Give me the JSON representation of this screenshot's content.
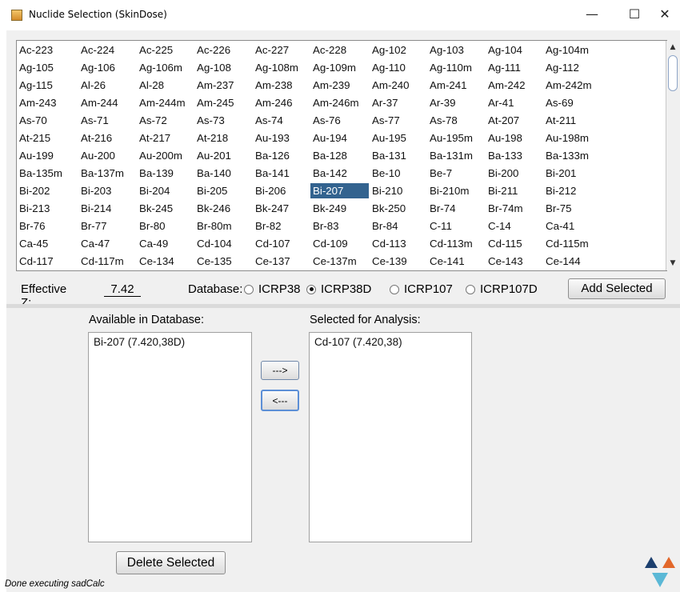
{
  "window": {
    "title": "Nuclide Selection (SkinDose)",
    "minimize_glyph": "—",
    "maximize_glyph": "☐",
    "close_glyph": "✕",
    "app_icon": "java-cup-icon"
  },
  "grid": {
    "selected": "Bi-207",
    "rows": [
      [
        "Ac-223",
        "Ac-224",
        "Ac-225",
        "Ac-226",
        "Ac-227",
        "Ac-228",
        "Ag-102",
        "Ag-103",
        "Ag-104",
        "Ag-104m"
      ],
      [
        "Ag-105",
        "Ag-106",
        "Ag-106m",
        "Ag-108",
        "Ag-108m",
        "Ag-109m",
        "Ag-110",
        "Ag-110m",
        "Ag-111",
        "Ag-112"
      ],
      [
        "Ag-115",
        "Al-26",
        "Al-28",
        "Am-237",
        "Am-238",
        "Am-239",
        "Am-240",
        "Am-241",
        "Am-242",
        "Am-242m"
      ],
      [
        "Am-243",
        "Am-244",
        "Am-244m",
        "Am-245",
        "Am-246",
        "Am-246m",
        "Ar-37",
        "Ar-39",
        "Ar-41",
        "As-69"
      ],
      [
        "As-70",
        "As-71",
        "As-72",
        "As-73",
        "As-74",
        "As-76",
        "As-77",
        "As-78",
        "At-207",
        "At-211"
      ],
      [
        "At-215",
        "At-216",
        "At-217",
        "At-218",
        "Au-193",
        "Au-194",
        "Au-195",
        "Au-195m",
        "Au-198",
        "Au-198m"
      ],
      [
        "Au-199",
        "Au-200",
        "Au-200m",
        "Au-201",
        "Ba-126",
        "Ba-128",
        "Ba-131",
        "Ba-131m",
        "Ba-133",
        "Ba-133m"
      ],
      [
        "Ba-135m",
        "Ba-137m",
        "Ba-139",
        "Ba-140",
        "Ba-141",
        "Ba-142",
        "Be-10",
        "Be-7",
        "Bi-200",
        "Bi-201"
      ],
      [
        "Bi-202",
        "Bi-203",
        "Bi-204",
        "Bi-205",
        "Bi-206",
        "Bi-207",
        "Bi-210",
        "Bi-210m",
        "Bi-211",
        "Bi-212"
      ],
      [
        "Bi-213",
        "Bi-214",
        "Bk-245",
        "Bk-246",
        "Bk-247",
        "Bk-249",
        "Bk-250",
        "Br-74",
        "Br-74m",
        "Br-75"
      ],
      [
        "Br-76",
        "Br-77",
        "Br-80",
        "Br-80m",
        "Br-82",
        "Br-83",
        "Br-84",
        "C-11",
        "C-14",
        "Ca-41"
      ],
      [
        "Ca-45",
        "Ca-47",
        "Ca-49",
        "Cd-104",
        "Cd-107",
        "Cd-109",
        "Cd-113",
        "Cd-113m",
        "Cd-115",
        "Cd-115m"
      ],
      [
        "Cd-117",
        "Cd-117m",
        "Ce-134",
        "Ce-135",
        "Ce-137",
        "Ce-137m",
        "Ce-139",
        "Ce-141",
        "Ce-143",
        "Ce-144"
      ]
    ]
  },
  "controls": {
    "effective_z_label": "Effective Z:",
    "effective_z_value": "7.42",
    "database_label": "Database:",
    "databases": [
      {
        "label": "ICRP38",
        "selected": false
      },
      {
        "label": "ICRP38D",
        "selected": true
      },
      {
        "label": "ICRP107",
        "selected": false
      },
      {
        "label": "ICRP107D",
        "selected": false
      }
    ],
    "add_selected": "Add Selected"
  },
  "available": {
    "label": "Available in Database:",
    "items": [
      "Bi-207 (7.420,38D)"
    ]
  },
  "selected": {
    "label": "Selected for Analysis:",
    "items": [
      "Cd-107 (7.420,38)"
    ]
  },
  "buttons": {
    "move_right": "--->",
    "move_left": "<---",
    "delete_selected": "Delete Selected"
  },
  "status": "Done executing sadCalc",
  "colors": {
    "selection": "#33638f",
    "logo_dark": "#1c3f6e",
    "logo_orange": "#e2672a",
    "logo_teal": "#5bb8d6"
  }
}
